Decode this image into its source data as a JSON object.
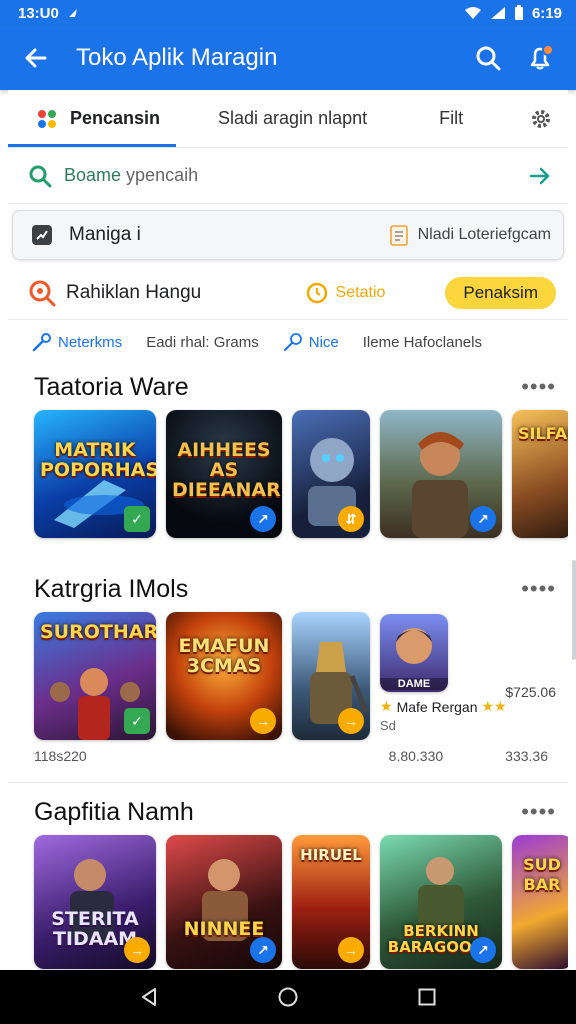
{
  "status_bar": {
    "time": "13:U0",
    "right_time": "6:19"
  },
  "app_bar": {
    "title": "Toko Aplik Maragin"
  },
  "tabs": [
    {
      "label": "Pencansin"
    },
    {
      "label": "Sladi aragin nlapnt"
    },
    {
      "label": "Filt"
    }
  ],
  "search": {
    "label_green": "Boame",
    "label_gray": " ypencaih"
  },
  "manage_card": {
    "label": "Maniga i",
    "note": "Nladi Loteriefgcam"
  },
  "filter_row": {
    "label": "Rahiklan Hangu",
    "secondary": "Setatio",
    "pill": "Penaksim"
  },
  "chips": [
    {
      "label": "Neterkms"
    },
    {
      "label": "Eadi rhal: Grams"
    },
    {
      "label": "Nice"
    },
    {
      "label": "Ileme Hafoclanels"
    }
  ],
  "sections": [
    {
      "title": "Taatoria Ware",
      "tiles": [
        {
          "text": "MATRIK POPORHAS",
          "badge": "✓"
        },
        {
          "text": "AIHHEES AS DIEEANAR",
          "badge": "↗"
        },
        {
          "text": "",
          "badge": "⇵"
        },
        {
          "text": "",
          "badge": "↗"
        },
        {
          "text": "SILFAL",
          "badge": ""
        }
      ]
    },
    {
      "title": "Katrgria IMols",
      "tiles": [
        {
          "text": "SUROTHAR",
          "badge": "✓"
        },
        {
          "text": "EMAFUN 3CMAS",
          "badge": "→"
        },
        {
          "text": "",
          "badge": "→"
        }
      ],
      "side_card": {
        "name": "DAME",
        "title": "Mafe Rergan",
        "price_top": "$725.06",
        "price_bottom": "333.36",
        "price_mid": "8.80.330"
      },
      "meta_left": "118s220"
    },
    {
      "title": "Gapfitia Namh",
      "tiles": [
        {
          "text": "STERITA TIDAAM",
          "badge": "→"
        },
        {
          "text": "NINNEE",
          "badge": "↗"
        },
        {
          "text": "HIRUEL",
          "badge": "→"
        },
        {
          "text": "BERKINN BARAGOOKS",
          "badge": "↗"
        },
        {
          "text": "SUD BAR",
          "badge": ""
        }
      ]
    }
  ],
  "more_label": "••••"
}
